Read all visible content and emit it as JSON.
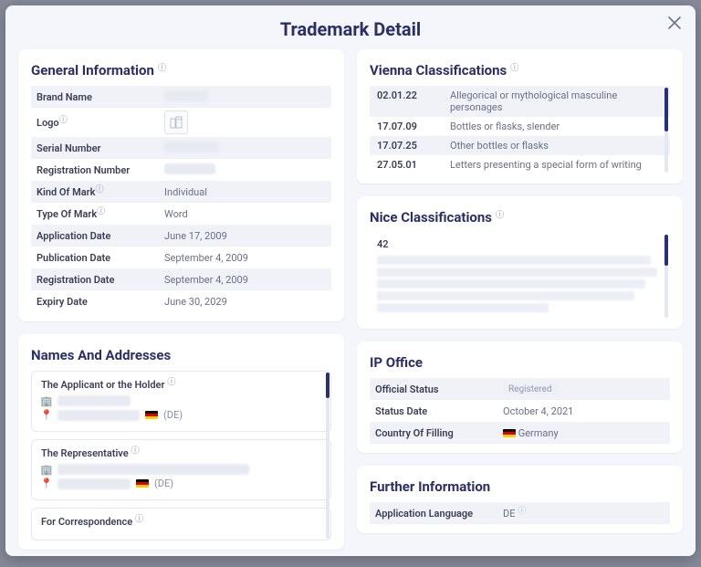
{
  "title": "Trademark Detail",
  "general": {
    "heading": "General Information",
    "rows": [
      {
        "k": "Brand Name",
        "v": "",
        "blur_w": 48
      },
      {
        "k": "Logo",
        "v": "",
        "logo": true
      },
      {
        "k": "Serial Number",
        "v": "",
        "blur_w": 60
      },
      {
        "k": "Registration Number",
        "v": "",
        "blur_w": 56
      },
      {
        "k": "Kind Of Mark",
        "v": "Individual"
      },
      {
        "k": "Type Of Mark",
        "v": "Word"
      },
      {
        "k": "Application Date",
        "v": "June 17, 2009"
      },
      {
        "k": "Publication Date",
        "v": "September 4, 2009"
      },
      {
        "k": "Registration Date",
        "v": "September 4, 2009"
      },
      {
        "k": "Expiry Date",
        "v": "June 30, 2029"
      }
    ]
  },
  "vienna": {
    "heading": "Vienna Classifications",
    "rows": [
      {
        "code": "02.01.22",
        "desc": "Allegorical or mythological masculine personages"
      },
      {
        "code": "17.07.09",
        "desc": "Bottles or flasks, slender"
      },
      {
        "code": "17.07.25",
        "desc": "Other bottles or flasks"
      },
      {
        "code": "27.05.01",
        "desc": "Letters presenting a special form of writing"
      }
    ]
  },
  "nice": {
    "heading": "Nice Classifications",
    "class_code": "42"
  },
  "names": {
    "heading": "Names And Addresses",
    "groups": [
      {
        "title": "The Applicant or the Holder",
        "country_code": "(DE)"
      },
      {
        "title": "The Representative",
        "country_code": "(DE)"
      },
      {
        "title": "For Correspondence"
      }
    ]
  },
  "ip_office": {
    "heading": "IP Office",
    "rows": [
      {
        "k": "Official Status",
        "pill": "Registered"
      },
      {
        "k": "Status Date",
        "v": "October 4, 2021"
      },
      {
        "k": "Country Of Filling",
        "flag": true,
        "v": "Germany"
      }
    ]
  },
  "further": {
    "heading": "Further Information",
    "rows": [
      {
        "k": "Application Language",
        "v": "DE"
      }
    ]
  }
}
